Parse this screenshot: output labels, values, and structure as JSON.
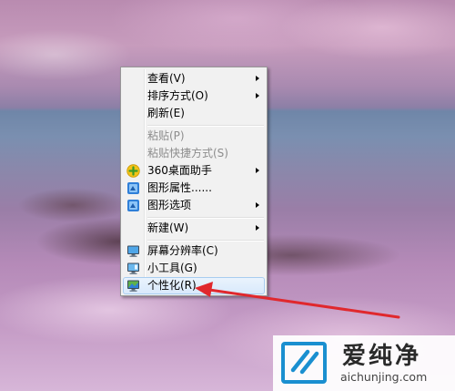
{
  "context_menu": {
    "items": [
      {
        "label": "查看(V)",
        "submenu": true,
        "disabled": false
      },
      {
        "label": "排序方式(O)",
        "submenu": true,
        "disabled": false
      },
      {
        "label": "刷新(E)",
        "submenu": false,
        "disabled": false
      },
      {
        "label": "粘贴(P)",
        "submenu": false,
        "disabled": true
      },
      {
        "label": "粘贴快捷方式(S)",
        "submenu": false,
        "disabled": true
      },
      {
        "label": "360桌面助手",
        "submenu": true,
        "disabled": false,
        "icon": "360-assistant-icon"
      },
      {
        "label": "图形属性......",
        "submenu": false,
        "disabled": false,
        "icon": "graphics-properties-icon"
      },
      {
        "label": "图形选项",
        "submenu": true,
        "disabled": false,
        "icon": "graphics-options-icon"
      },
      {
        "label": "新建(W)",
        "submenu": true,
        "disabled": false
      },
      {
        "label": "屏幕分辨率(C)",
        "submenu": false,
        "disabled": false,
        "icon": "monitor-icon"
      },
      {
        "label": "小工具(G)",
        "submenu": false,
        "disabled": false,
        "icon": "gadgets-icon"
      },
      {
        "label": "个性化(R)",
        "submenu": false,
        "disabled": false,
        "icon": "personalize-icon",
        "highlighted": true
      }
    ]
  },
  "watermark": {
    "name_cn": "爱纯净",
    "domain": "aichunjing.com"
  },
  "colors": {
    "annotation_arrow": "#e0282d",
    "menu_background": "#f1f1f1",
    "disabled_text": "#8d8d8d"
  }
}
